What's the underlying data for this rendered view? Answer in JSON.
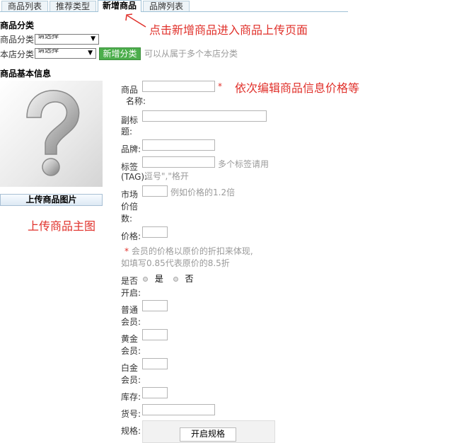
{
  "tabs": [
    {
      "label": "商品列表"
    },
    {
      "label": "推荐类型"
    },
    {
      "label": "新增商品"
    },
    {
      "label": "品牌列表"
    }
  ],
  "annotations": {
    "tab_note": "点击新增商品进入商品上传页面",
    "edit_note": "依次编辑商品信息价格等",
    "image_note": "上传商品主图"
  },
  "category": {
    "title": "商品分类",
    "product_category_label": "商品分类:",
    "product_category_value": "请选择",
    "shop_category_label": "本店分类:",
    "shop_category_value": "请选择",
    "add_button": "新增分类",
    "hint": "可以从属于多个本店分类"
  },
  "basic_info": {
    "title": "商品基本信息",
    "upload_button": "上传商品图片"
  },
  "form": {
    "name_label_1": "商品",
    "name_label_2": "名称:",
    "required_mark": "*",
    "subtitle_label_1": "副标",
    "subtitle_label_2": "题:",
    "brand_label": "品牌:",
    "tag_label_1": "标签",
    "tag_label_2": "(TAG):",
    "tag_hint_1": "多个标签请用",
    "tag_hint_2": "逗号\",\"格开",
    "market_label_1": "市场",
    "market_label_2": "价倍",
    "market_label_3": "数:",
    "market_hint": "例如价格的1.2倍",
    "price_label": "价格:",
    "member_note_star": "*",
    "member_note_1": "会员的价格以原价的折扣来体现,",
    "member_note_2": "如填写0.85代表原价的8.5折",
    "enable_label_1": "是否",
    "enable_label_2": "开启:",
    "enable_yes": "是",
    "enable_no": "否",
    "normal_label_1": "普通",
    "normal_label_2": "会员:",
    "gold_label_1": "黄金",
    "gold_label_2": "会员:",
    "platinum_label_1": "白金",
    "platinum_label_2": "会员:",
    "stock_label": "库存:",
    "sku_label": "货号:",
    "spec_label": "规格:",
    "spec_button": "开启规格"
  },
  "colors": {
    "annotation": "#e0302a",
    "add_button": "#4cae4c"
  }
}
